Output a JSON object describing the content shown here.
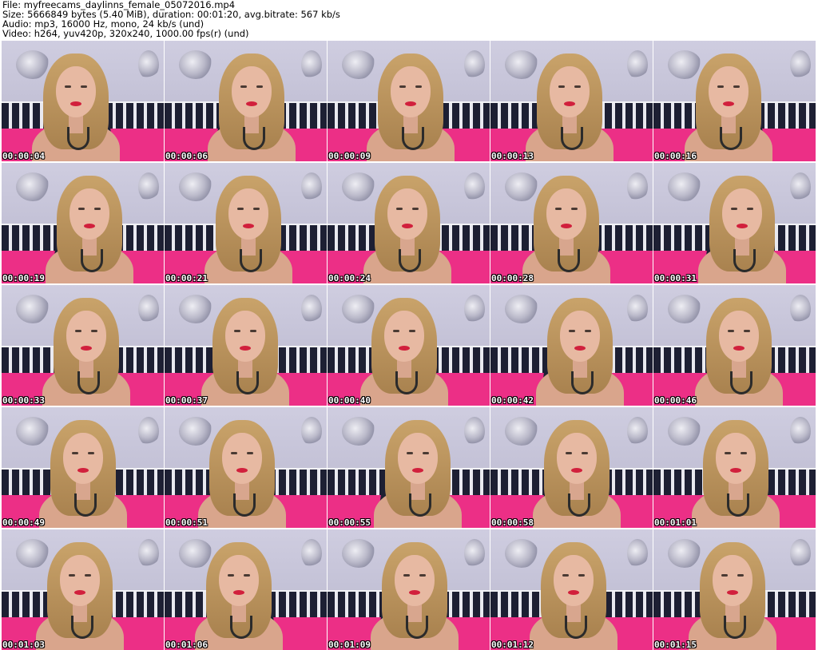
{
  "header": {
    "file": "File: myfreecams_daylinns_female_05072016.mp4",
    "size": "Size: 5666849 bytes (5.40 MiB), duration: 00:01:20, avg.bitrate: 567 kb/s",
    "audio": "Audio: mp3, 16000 Hz, mono, 24 kb/s (und)",
    "video": "Video: h264, yuv420p, 320x240, 1000.00 fps(r) (und)"
  },
  "frames": [
    {
      "time": "00:00:04"
    },
    {
      "time": "00:00:06"
    },
    {
      "time": "00:00:09"
    },
    {
      "time": "00:00:13"
    },
    {
      "time": "00:00:16"
    },
    {
      "time": "00:00:19"
    },
    {
      "time": "00:00:21"
    },
    {
      "time": "00:00:24"
    },
    {
      "time": "00:00:28"
    },
    {
      "time": "00:00:31"
    },
    {
      "time": "00:00:33"
    },
    {
      "time": "00:00:37"
    },
    {
      "time": "00:00:40"
    },
    {
      "time": "00:00:42"
    },
    {
      "time": "00:00:46"
    },
    {
      "time": "00:00:49"
    },
    {
      "time": "00:00:51"
    },
    {
      "time": "00:00:55"
    },
    {
      "time": "00:00:58"
    },
    {
      "time": "00:01:01"
    },
    {
      "time": "00:01:03"
    },
    {
      "time": "00:01:06"
    },
    {
      "time": "00:01:09"
    },
    {
      "time": "00:01:12"
    },
    {
      "time": "00:01:15"
    }
  ],
  "colors": {
    "wall": "#c9c7d9",
    "stripe_dark": "#1d1f33",
    "pink": "#ec2f86",
    "hair": "#c9a36a",
    "skin": "#e7b9a2",
    "lips": "#d1203c"
  }
}
